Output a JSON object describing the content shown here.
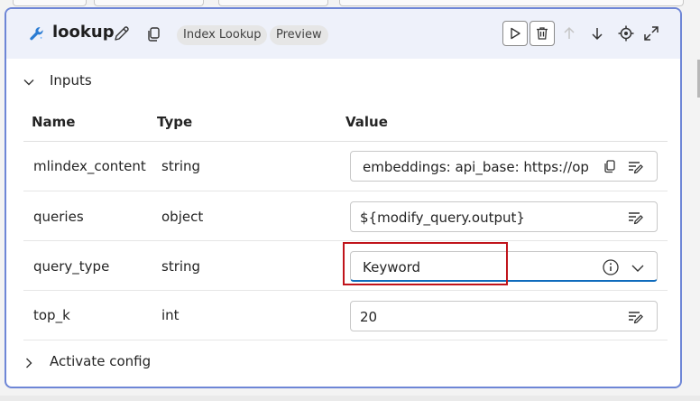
{
  "header": {
    "title": "lookup",
    "tags": [
      "Index Lookup",
      "Preview"
    ],
    "icons": [
      "pencil-icon",
      "copy-icon",
      "run-icon",
      "delete-icon",
      "arrow-up-icon",
      "arrow-down-icon",
      "locate-icon",
      "expand-icon"
    ]
  },
  "inputs": {
    "label": "Inputs",
    "columns": {
      "name": "Name",
      "type": "Type",
      "value": "Value"
    },
    "rows": [
      {
        "name": "mlindex_content",
        "type": "string",
        "value": "embeddings:  api_base: https://oper"
      },
      {
        "name": "queries",
        "type": "object",
        "value": "${modify_query.output}"
      },
      {
        "name": "query_type",
        "type": "string",
        "value": "Keyword"
      },
      {
        "name": "top_k",
        "type": "int",
        "value": "20"
      }
    ]
  },
  "activate": {
    "label": "Activate config"
  },
  "colors": {
    "accent": "#0f6cbd",
    "node_border": "#6e86d6",
    "highlight": "#c0141b",
    "header_bg": "#eef1fa"
  }
}
